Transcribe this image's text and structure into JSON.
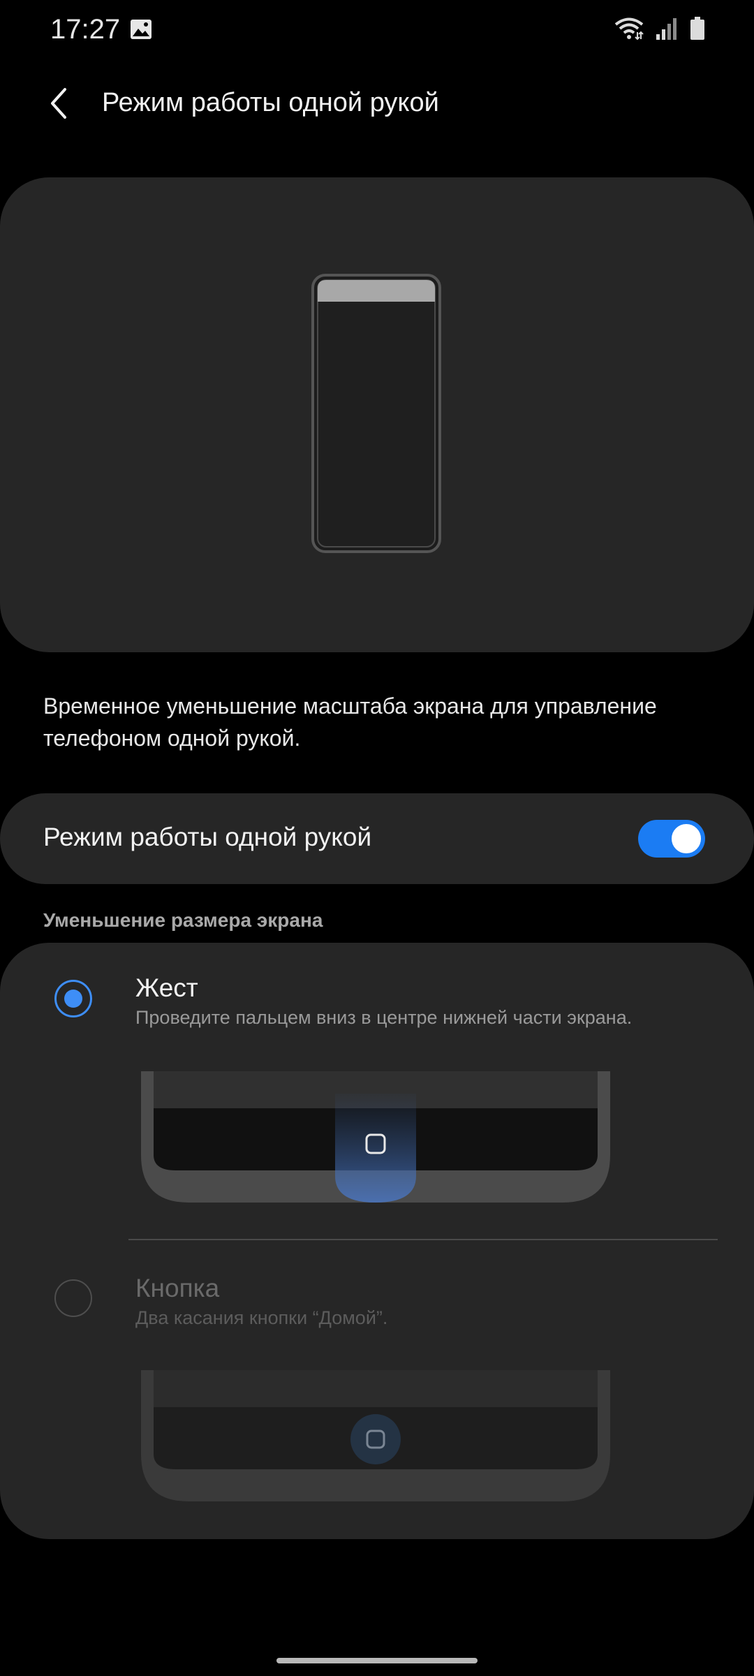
{
  "status_bar": {
    "time": "17:27",
    "left_icon": "image-notification-icon",
    "right_icons": [
      "wifi-icon",
      "signal-icon",
      "battery-icon"
    ]
  },
  "header": {
    "back_icon": "chevron-left-icon",
    "title": "Режим работы одной рукой"
  },
  "description": "Временное уменьшение масштаба экрана для управление телефоном одной рукой.",
  "toggle": {
    "label": "Режим работы одной рукой",
    "state": "on",
    "accent_color": "#1b7cf3"
  },
  "section_label": "Уменьшение размера экрана",
  "options": [
    {
      "title": "Жест",
      "subtitle": "Проведите пальцем вниз в центре нижней части экрана.",
      "selected": true
    },
    {
      "title": "Кнопка",
      "subtitle": "Два касания кнопки “Домой”.",
      "selected": false
    }
  ],
  "colors": {
    "background": "#000000",
    "card": "#262626",
    "radio_selected": "#3e8ef7"
  }
}
